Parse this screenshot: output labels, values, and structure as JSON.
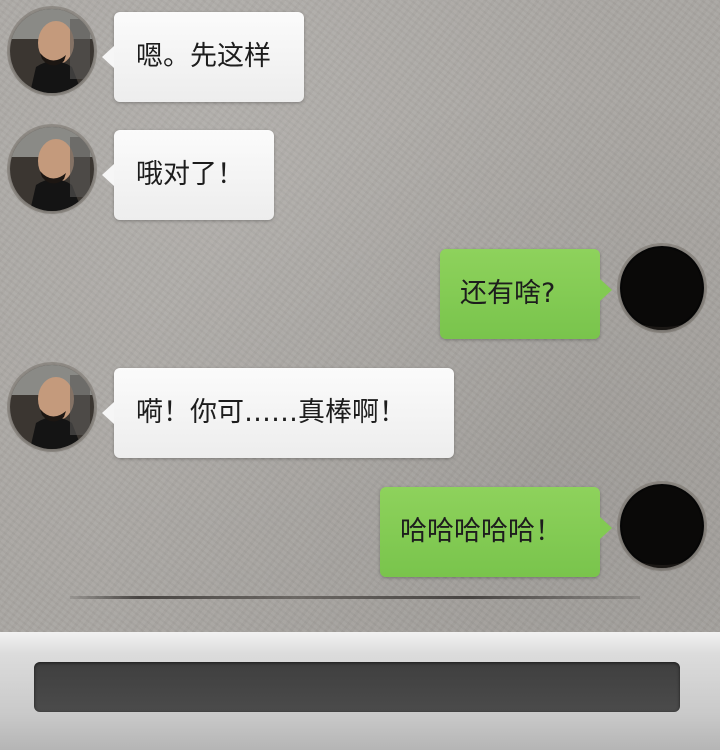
{
  "conversation": {
    "messages": [
      {
        "sender": "contact",
        "text": "嗯。先这样"
      },
      {
        "sender": "contact",
        "text": "哦对了！"
      },
      {
        "sender": "me",
        "text": "还有啥?"
      },
      {
        "sender": "contact",
        "text": "嗬！你可……真棒啊！"
      },
      {
        "sender": "me",
        "text": "哈哈哈哈哈！"
      }
    ]
  },
  "composer": {
    "input_value": ""
  },
  "colors": {
    "incoming_bubble": "#f4f4f4",
    "outgoing_bubble": "#82ca52",
    "background": "#a9a6a2",
    "input_field": "#454545"
  },
  "icons": {
    "contact_avatar": "contact-avatar-icon",
    "my_avatar": "my-avatar-icon"
  }
}
